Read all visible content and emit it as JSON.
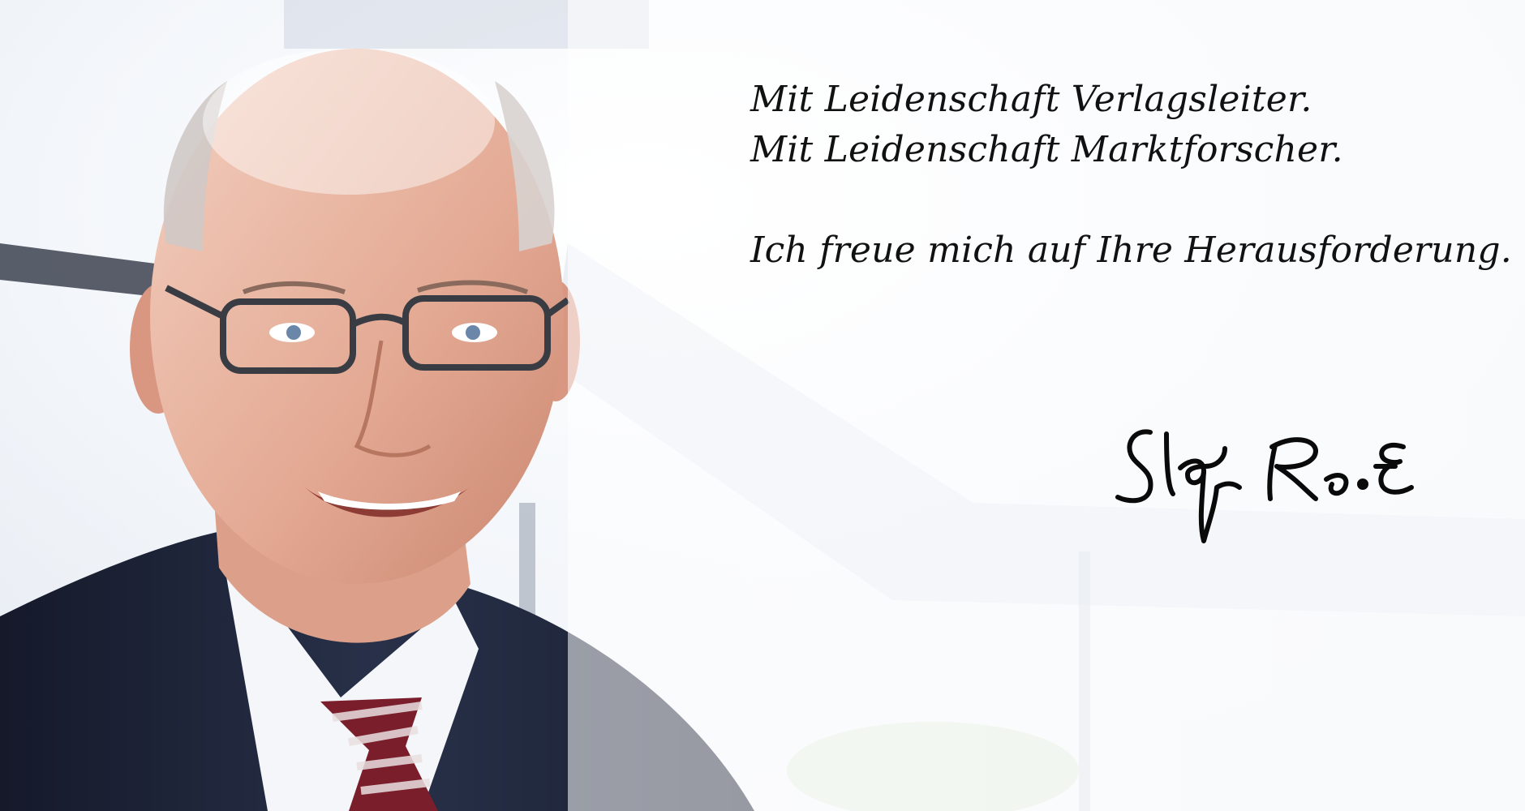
{
  "quote": {
    "line1": "Mit Leidenschaft Verlagsleiter.",
    "line2": "Mit Leidenschaft Marktforscher.",
    "line3": "Ich freue mich auf Ihre Herausforderung."
  },
  "signature": {
    "text": "Stefan Raab"
  },
  "colors": {
    "text": "#111111",
    "suit": "#1d2433",
    "tie_red": "#7a1e2b",
    "skin": "#e9b7a0"
  }
}
